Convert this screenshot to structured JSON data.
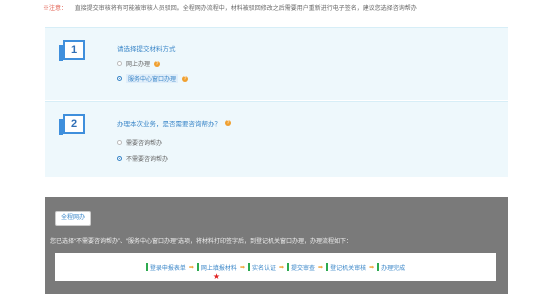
{
  "notice": {
    "tag": "※注意：",
    "text": "直接提交审核将有可能被审核人员驳回。全程网办流程中，材料被驳回修改之后需要用户重新进行电子签名，建议您选择咨询帮办"
  },
  "step1": {
    "number": "1",
    "question": "请选择提交材料方式",
    "options": [
      {
        "label": "网上办理",
        "selected": false,
        "help": true
      },
      {
        "label": "服务中心窗口办理",
        "selected": true,
        "help": true
      }
    ]
  },
  "step2": {
    "number": "2",
    "question": "办理本次业务，是否需要咨询帮办？",
    "options": [
      {
        "label": "需要咨询帮办",
        "selected": false
      },
      {
        "label": "不需要咨询帮办",
        "selected": true
      }
    ]
  },
  "process": {
    "button_label": "全程网办",
    "description": "您已选择“不需要咨询帮办”、“服务中心窗口办理”选项，将材料打印签字后，到登记机关窗口办理，办理流程如下：",
    "steps": [
      "登录申报表单",
      "网上填报材料",
      "实名认证",
      "提交审查",
      "登记机关审核",
      "办理完成"
    ],
    "starred_step_index": 1
  },
  "colors": {
    "accent": "#3a86c8",
    "warning": "#f0a030",
    "danger": "#e05a4b",
    "panel_bg": "#eef8fc",
    "dark_bg": "#7a7a7a",
    "step_bar": "#2eaa4f"
  }
}
